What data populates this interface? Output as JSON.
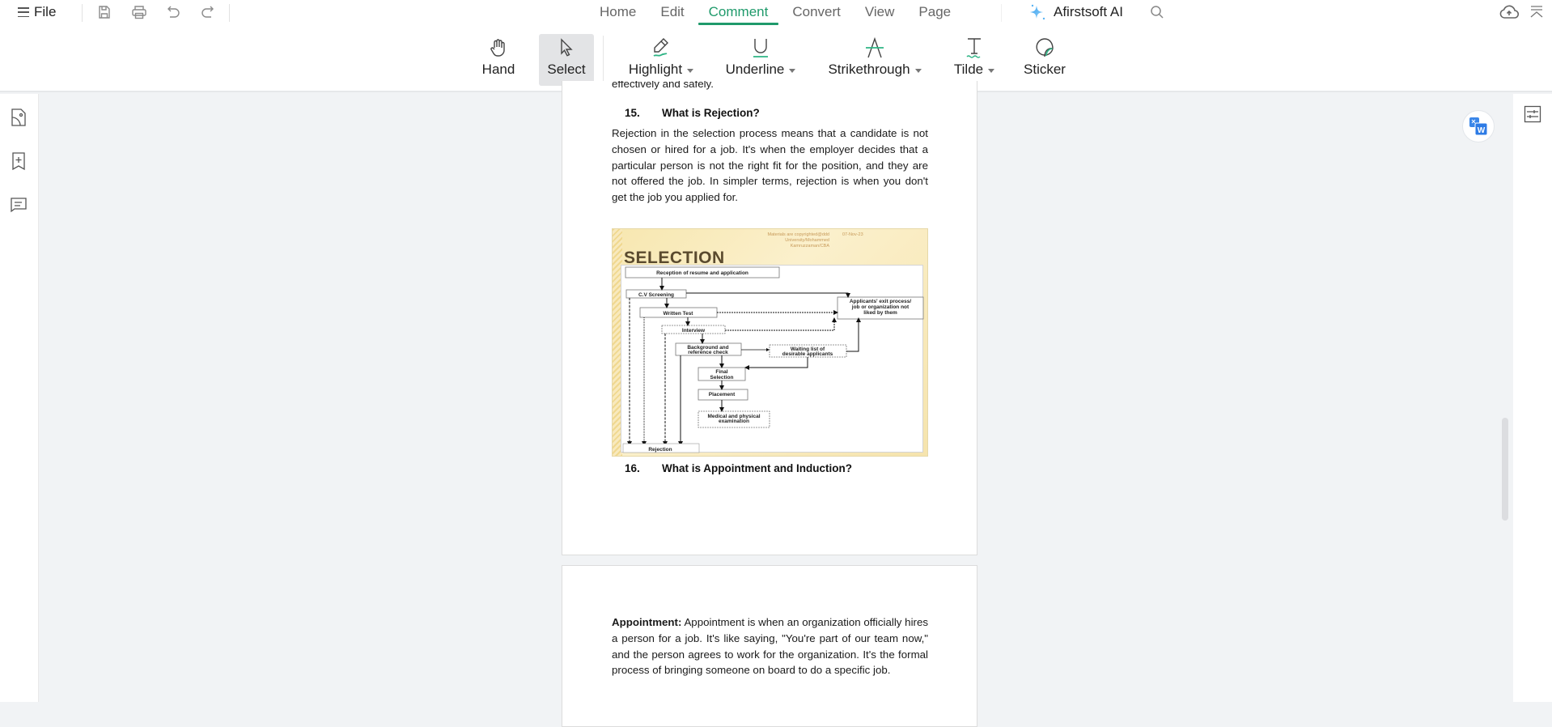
{
  "topbar": {
    "file_label": "File",
    "quick_actions": [
      "save-icon",
      "print-icon",
      "undo-icon",
      "redo-icon"
    ],
    "menu_tabs": [
      {
        "label": "Home",
        "active": false
      },
      {
        "label": "Edit",
        "active": false
      },
      {
        "label": "Comment",
        "active": true
      },
      {
        "label": "Convert",
        "active": false
      },
      {
        "label": "View",
        "active": false
      },
      {
        "label": "Page",
        "active": false
      }
    ],
    "ai_label": "Afirstsoft AI",
    "accent_color": "#1f9a6b"
  },
  "ribbon": {
    "tools": [
      {
        "label": "Hand",
        "has_dropdown": false,
        "selected": false
      },
      {
        "label": "Select",
        "has_dropdown": false,
        "selected": true
      },
      {
        "label": "Highlight",
        "has_dropdown": true,
        "selected": false
      },
      {
        "label": "Underline",
        "has_dropdown": true,
        "selected": false
      },
      {
        "label": "Strikethrough",
        "has_dropdown": true,
        "selected": false
      },
      {
        "label": "Tilde",
        "has_dropdown": true,
        "selected": false
      },
      {
        "label": "Sticker",
        "has_dropdown": false,
        "selected": false
      }
    ]
  },
  "left_rail": [
    "thumbnail-icon",
    "bookmark-icon",
    "comment-icon"
  ],
  "document": {
    "page1": {
      "cutoff_text": "effectively and safely.",
      "q15_number": "15.",
      "q15_title": "What is Rejection?",
      "q15_body": "Rejection in the selection process means that a candidate is not chosen or hired for a job. It's when the employer decides that a particular person is not the right fit for the position, and they are not offered the job. In simpler terms, rejection is when you don't get the job you applied for.",
      "q16_number": "16.",
      "q16_title": "What is Appointment and Induction?"
    },
    "figure": {
      "title": "SELECTION",
      "credit_lines": [
        "Materials are copyrighted@ddd",
        "University/Mohammed",
        "Kamruzzaman/CBA"
      ],
      "date": "07-Nov-23",
      "boxes": {
        "reception": "Reception of resume and application",
        "cv": "C.V Screening",
        "written": "Written Test",
        "interview": "Interview",
        "background_1": "Background and",
        "background_2": "reference check",
        "waiting_1": "Waiting list of",
        "waiting_2": "desirable applicants",
        "final_1": "Final",
        "final_2": "Selection",
        "placement": "Placement",
        "medical_1": "Medical and physical",
        "medical_2": "examination",
        "exit_1": "Applicants' exit process/",
        "exit_2": "job or organization not",
        "exit_3": "liked by them",
        "rejection": "Rejection"
      }
    },
    "page2": {
      "appointment_label": "Appointment:",
      "appointment_body": "Appointment is when an organization officially hires a person for a job. It's like saying, \"You're part of our team now,\" and the person agrees to work for the organization. It's the formal process of bringing someone on board to do a specific job."
    }
  }
}
